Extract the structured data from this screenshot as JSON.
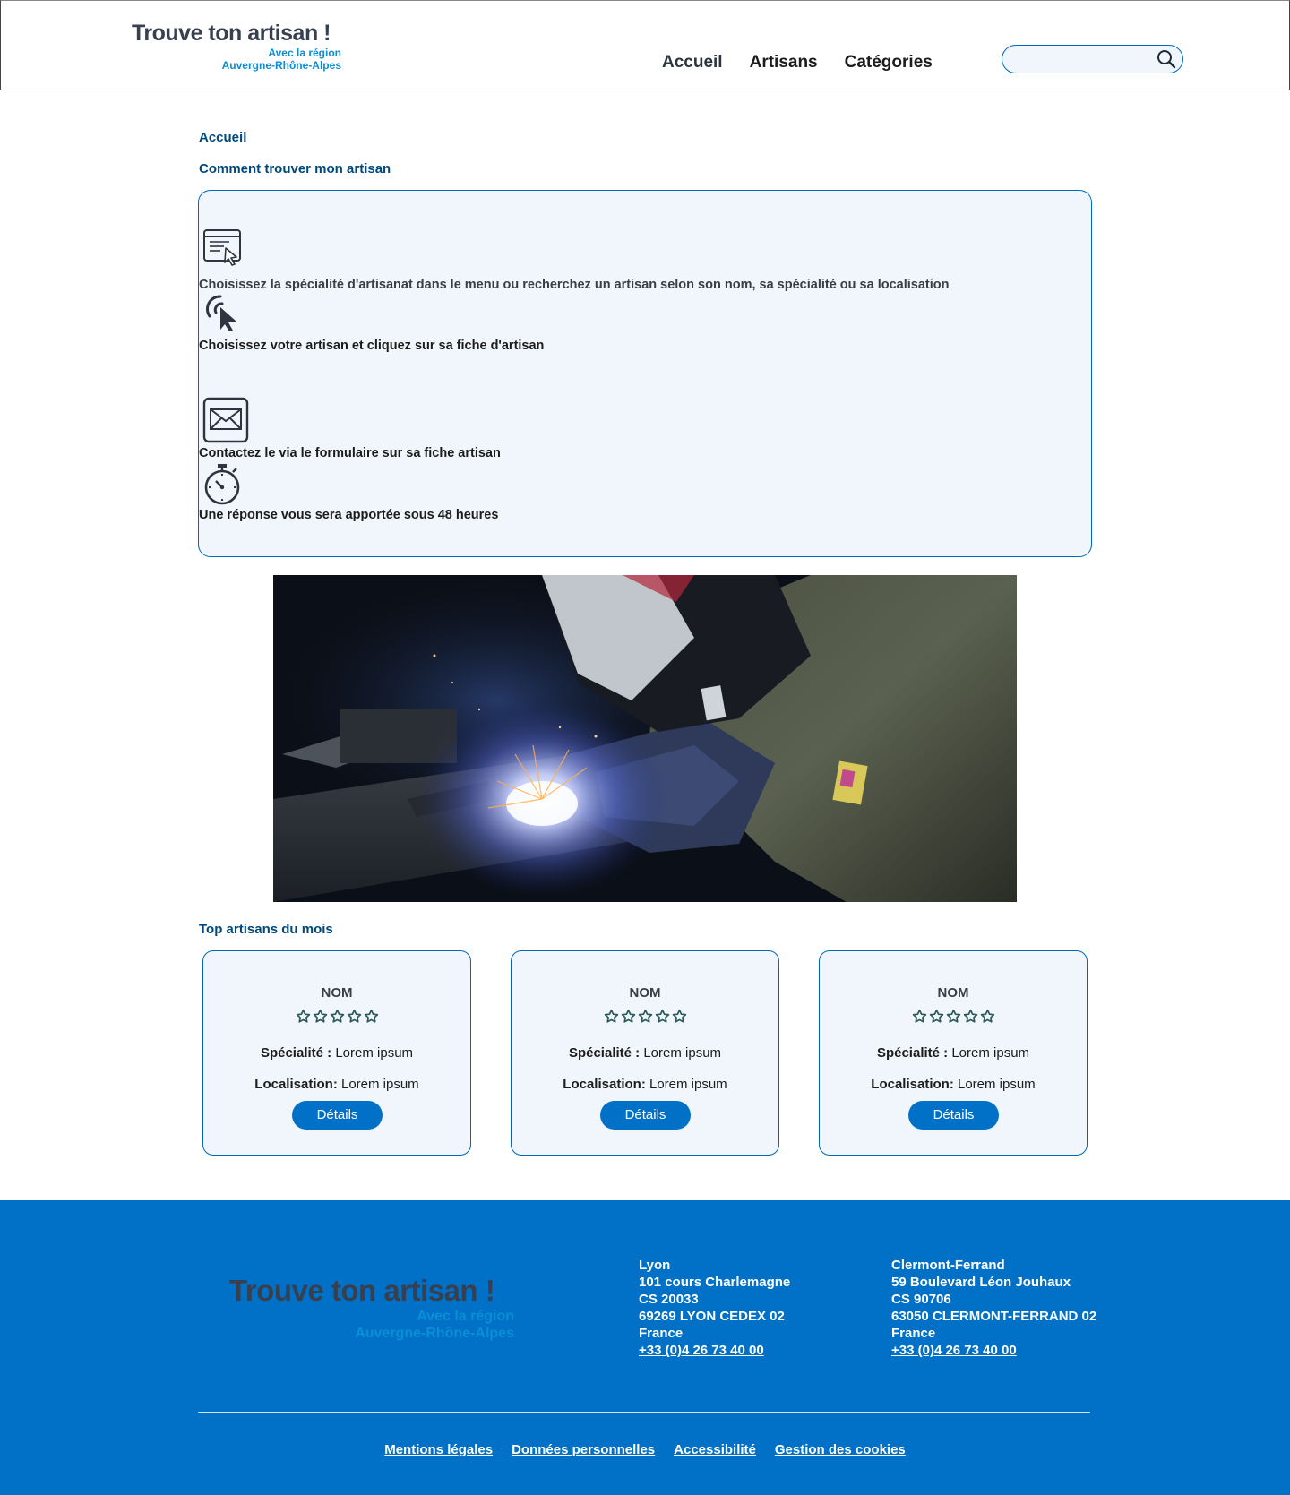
{
  "header": {
    "logo": {
      "title": "Trouve ton artisan !",
      "sub1": "Avec la région",
      "sub2": "Auvergne-Rhône-Alpes"
    },
    "nav": [
      {
        "label": "Accueil"
      },
      {
        "label": "Artisans"
      },
      {
        "label": "Catégories"
      }
    ],
    "search": {
      "placeholder": "",
      "icon": "search-icon"
    }
  },
  "breadcrumb": "Accueil",
  "how_to": {
    "title": "Comment trouver mon artisan",
    "steps": [
      {
        "icon": "browser-cursor-icon",
        "text": "Choisissez la spécialité d'artisanat dans le menu ou recherchez un artisan selon son nom, sa spécialité ou sa localisation"
      },
      {
        "icon": "tap-pointer-icon",
        "text": "Choisissez votre artisan et cliquez sur sa fiche d'artisan"
      },
      {
        "icon": "envelope-icon",
        "text": "Contactez le via le formulaire sur sa fiche artisan"
      },
      {
        "icon": "stopwatch-icon",
        "text": "Une réponse vous sera apportée sous 48 heures"
      }
    ]
  },
  "hero": {
    "subject": "welder-photo"
  },
  "top": {
    "title": "Top artisans du mois",
    "cards": [
      {
        "name": "NOM",
        "rating": 0,
        "specialty_label": "Spécialité :",
        "specialty": "Lorem ipsum",
        "location_label": "Localisation:",
        "location": "Lorem ipsum",
        "button": "Détails"
      },
      {
        "name": "NOM",
        "rating": 0,
        "specialty_label": "Spécialité :",
        "specialty": "Lorem ipsum",
        "location_label": "Localisation:",
        "location": "Lorem ipsum",
        "button": "Détails"
      },
      {
        "name": "NOM",
        "rating": 0,
        "specialty_label": "Spécialité :",
        "specialty": "Lorem ipsum",
        "location_label": "Localisation:",
        "location": "Lorem ipsum",
        "button": "Détails"
      }
    ]
  },
  "footer": {
    "logo": {
      "title": "Trouve ton artisan !",
      "sub1": "Avec la région",
      "sub2": "Auvergne-Rhône-Alpes"
    },
    "addresses": [
      {
        "city": "Lyon",
        "line1": "101 cours Charlemagne",
        "line2": "CS 20033",
        "line3": "69269 LYON CEDEX 02",
        "country": "France",
        "phone": "+33 (0)4 26 73 40 00"
      },
      {
        "city": "Clermont-Ferrand",
        "line1": "59 Boulevard Léon Jouhaux",
        "line2": "CS 90706",
        "line3": "63050 CLERMONT-FERRAND 02",
        "country": "France",
        "phone": "+33 (0)4 26 73 40 00"
      }
    ],
    "links": [
      {
        "label": "Mentions légales"
      },
      {
        "label": "Données personnelles"
      },
      {
        "label": "Accessibilité"
      },
      {
        "label": "Gestion des cookies"
      }
    ]
  },
  "colors": {
    "primary": "#0071c7",
    "dark_blue": "#00497c",
    "box_bg": "#f0f6fb",
    "logo_dark": "#384050",
    "logo_light": "#0a8fd6"
  }
}
